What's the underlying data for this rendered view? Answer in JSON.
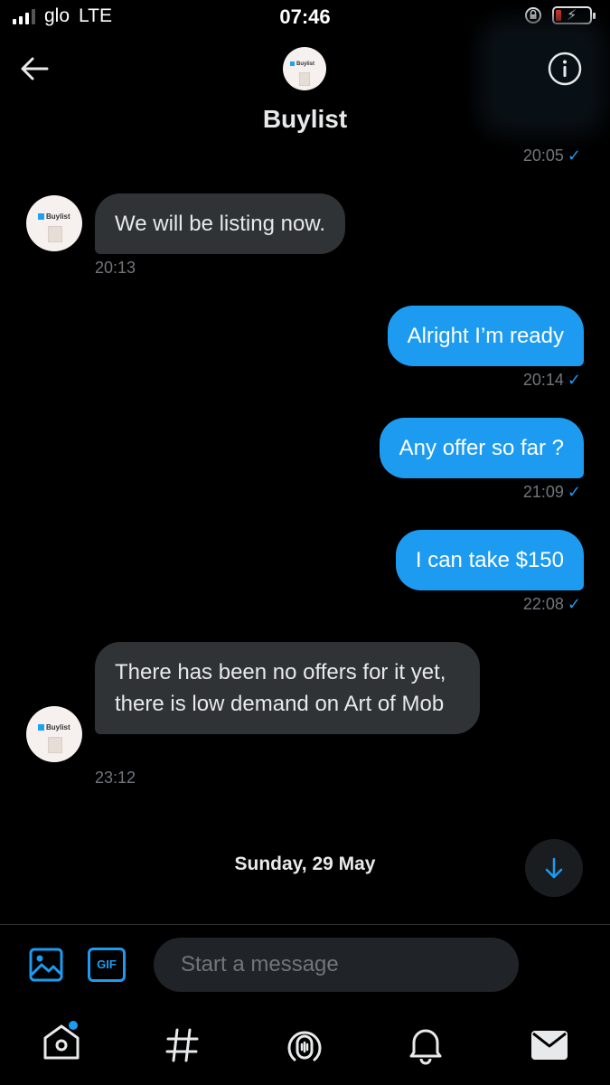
{
  "status_bar": {
    "carrier": "glo",
    "network": "LTE",
    "time": "07:46"
  },
  "header": {
    "title": "Buylist",
    "avatar_brand": "Buylist"
  },
  "messages": [
    {
      "direction": "out",
      "time": "20:05",
      "read": true
    },
    {
      "direction": "in",
      "text": "We will be listing now.",
      "time": "20:13"
    },
    {
      "direction": "out",
      "text": "Alright I’m ready",
      "time": "20:14",
      "read": true
    },
    {
      "direction": "out",
      "text": "Any offer so far ?",
      "time": "21:09",
      "read": true
    },
    {
      "direction": "out",
      "text": "I can take $150",
      "time": "22:08",
      "read": true
    },
    {
      "direction": "in",
      "text": "There has been no offers for it yet, there is low demand on Art of Mob",
      "time": "23:12"
    }
  ],
  "date_separator": "Sunday, 29 May",
  "composer": {
    "placeholder": "Start a message",
    "gif_label": "GIF"
  },
  "icons": {
    "back": "back-arrow-icon",
    "info": "info-icon",
    "scroll": "arrow-down-icon",
    "image": "image-icon",
    "voice": "voice-wave-icon",
    "nav": [
      "home-icon",
      "hashtag-icon",
      "spaces-icon",
      "bell-icon",
      "mail-icon"
    ]
  },
  "colors": {
    "accent": "#1d9bf0",
    "incoming_bubble": "#2f3336",
    "background": "#000000",
    "unread_dot": "#1d9bf0"
  }
}
